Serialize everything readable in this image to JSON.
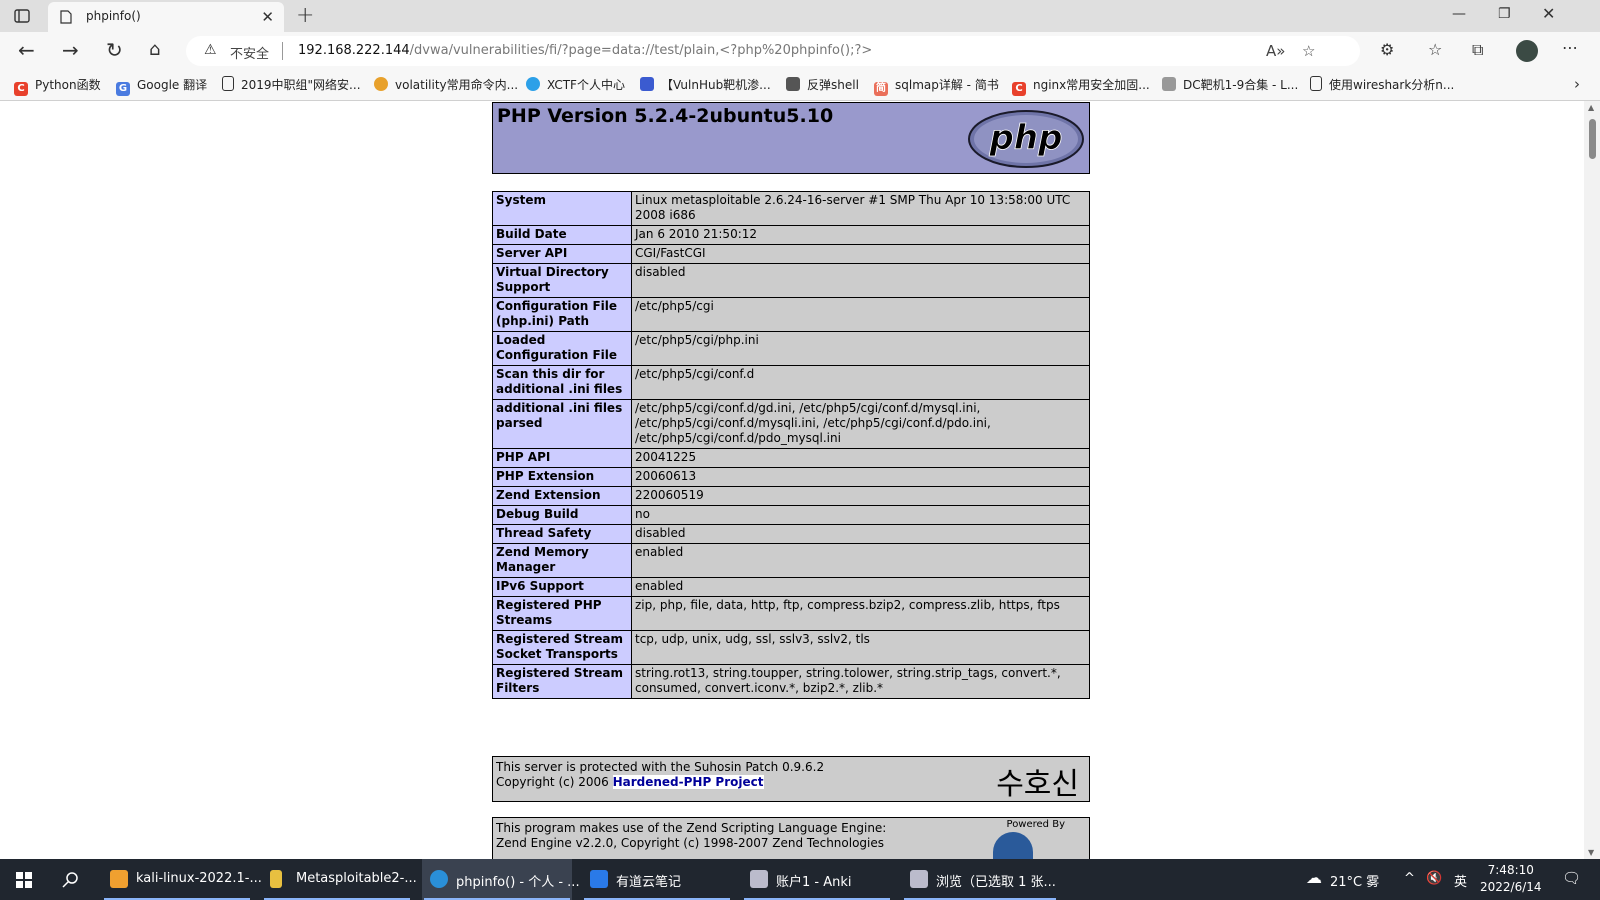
{
  "browser": {
    "tab_title": "phpinfo()",
    "insecure_label": "不安全",
    "url_host": "192.168.222.144",
    "url_rest": "/dvwa/vulnerabilities/fi/?page=data://test/plain,<?php%20phpinfo();?>",
    "bookmarks": [
      {
        "label": "Python函数",
        "color": "#e8412c"
      },
      {
        "label": "Google 翻译",
        "color": "#4a7be0"
      },
      {
        "label": "2019中职组\"网络安...",
        "color": "#ffffff"
      },
      {
        "label": "volatility常用命令内...",
        "color": "#e8a12c"
      },
      {
        "label": "XCTF个人中心",
        "color": "#2ca0e8"
      },
      {
        "label": "【VulnHub靶机渗...",
        "color": "#3b5bd0"
      },
      {
        "label": "反弹shell",
        "color": "#555555"
      },
      {
        "label": "sqlmap详解 - 简书",
        "color": "#ea6f5a"
      },
      {
        "label": "nginx常用安全加固...",
        "color": "#e8412c"
      },
      {
        "label": "DC靶机1-9合集 - L...",
        "color": "#999999"
      },
      {
        "label": "使用wireshark分析n...",
        "color": "#ffffff"
      }
    ]
  },
  "phpinfo": {
    "title": "PHP Version 5.2.4-2ubuntu5.10",
    "logo_text": "php",
    "rows": [
      {
        "key": "System",
        "value": "Linux metasploitable 2.6.24-16-server #1 SMP Thu Apr 10 13:58:00 UTC 2008 i686"
      },
      {
        "key": "Build Date",
        "value": "Jan 6 2010 21:50:12"
      },
      {
        "key": "Server API",
        "value": "CGI/FastCGI"
      },
      {
        "key": "Virtual Directory Support",
        "value": "disabled"
      },
      {
        "key": "Configuration File (php.ini) Path",
        "value": "/etc/php5/cgi"
      },
      {
        "key": "Loaded Configuration File",
        "value": "/etc/php5/cgi/php.ini"
      },
      {
        "key": "Scan this dir for additional .ini files",
        "value": "/etc/php5/cgi/conf.d"
      },
      {
        "key": "additional .ini files parsed",
        "value": "/etc/php5/cgi/conf.d/gd.ini, /etc/php5/cgi/conf.d/mysql.ini, /etc/php5/cgi/conf.d/mysqli.ini, /etc/php5/cgi/conf.d/pdo.ini, /etc/php5/cgi/conf.d/pdo_mysql.ini"
      },
      {
        "key": "PHP API",
        "value": "20041225"
      },
      {
        "key": "PHP Extension",
        "value": "20060613"
      },
      {
        "key": "Zend Extension",
        "value": "220060519"
      },
      {
        "key": "Debug Build",
        "value": "no"
      },
      {
        "key": "Thread Safety",
        "value": "disabled"
      },
      {
        "key": "Zend Memory Manager",
        "value": "enabled"
      },
      {
        "key": "IPv6 Support",
        "value": "enabled"
      },
      {
        "key": "Registered PHP Streams",
        "value": "zip, php, file, data, http, ftp, compress.bzip2, compress.zlib, https, ftps"
      },
      {
        "key": "Registered Stream Socket Transports",
        "value": "tcp, udp, unix, udg, ssl, sslv3, sslv2, tls"
      },
      {
        "key": "Registered Stream Filters",
        "value": "string.rot13, string.toupper, string.tolower, string.strip_tags, convert.*, consumed, convert.iconv.*, bzip2.*, zlib.*"
      }
    ],
    "suhosin_line1": "This server is protected with the Suhosin Patch 0.9.6.2",
    "suhosin_line2_prefix": "Copyright (c) 2006 ",
    "suhosin_link": "Hardened-PHP Project",
    "suhosin_korean": "수호신",
    "zend_line1": "This program makes use of the Zend Scripting Language Engine:",
    "zend_line2": "Zend Engine v2.2.0, Copyright (c) 1998-2007 Zend Technologies",
    "zend_powered": "Powered By"
  },
  "taskbar": {
    "items": [
      {
        "label": "kali-linux-2022.1-...",
        "color": "#f0a030"
      },
      {
        "label": "Metasploitable2-...",
        "color": "#e8c040"
      },
      {
        "label": "phpinfo() - 个人 - ...",
        "color": "#2a8fd8"
      },
      {
        "label": "有道云笔记",
        "color": "#2a7ae8"
      },
      {
        "label": "账户1 - Anki",
        "color": "#bbbbcc"
      },
      {
        "label": "浏览（已选取 1 张...",
        "color": "#bbbbcc"
      }
    ],
    "weather": "21°C 雾",
    "ime": "英",
    "time": "7:48:10",
    "date": "2022/6/14"
  }
}
